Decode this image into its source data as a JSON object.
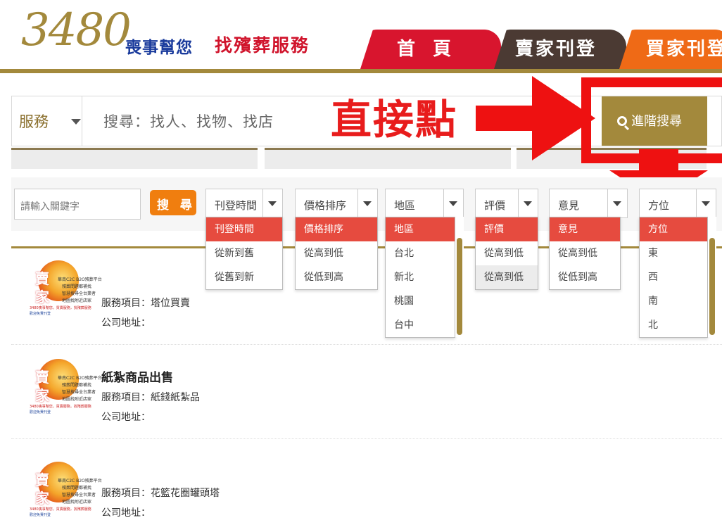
{
  "header": {
    "logo_number": "3480",
    "tagline_1": "喪事幫您",
    "tagline_2": "找殯葬服務",
    "nav": [
      {
        "label": "首 頁"
      },
      {
        "label": "賣家刊登"
      },
      {
        "label": "買家刊登"
      }
    ]
  },
  "search": {
    "category": "服務",
    "placeholder": "搜尋：找人、找物、找店",
    "advanced_label": "進階搜尋"
  },
  "annotation": {
    "text": "直接點"
  },
  "filters": {
    "keyword_placeholder": "請輸入關鍵字",
    "go_label": "搜 尋",
    "selects": [
      {
        "label": "刊登時間",
        "options": [
          "刊登時間",
          "從新到舊",
          "從舊到新"
        ]
      },
      {
        "label": "價格排序",
        "options": [
          "價格排序",
          "從高到低",
          "從低到高"
        ]
      },
      {
        "label": "地區",
        "options": [
          "地區",
          "台北",
          "新北",
          "桃園",
          "台中"
        ]
      },
      {
        "label": "評價",
        "options": [
          "評價",
          "從高到低",
          "從高到低"
        ]
      },
      {
        "label": "意見",
        "options": [
          "意見",
          "從高到低",
          "從低到高"
        ]
      },
      {
        "label": "方位",
        "options": [
          "方位",
          "東",
          "西",
          "南",
          "北"
        ]
      }
    ]
  },
  "listings": [
    {
      "title": "",
      "service": "服務項目：塔位買賣",
      "address": "公司地址："
    },
    {
      "title": "紙紮商品出售",
      "service": "服務項目：紙錢紙紮品",
      "address": "公司地址："
    },
    {
      "title": "",
      "service": "服務項目：花籃花圈罐頭塔",
      "address": "公司地址："
    }
  ],
  "logo_badge": {
    "char_1": "賣",
    "char_2": "家",
    "line_1": "華南C2C B2O殯葬平台",
    "line_2": "殯葬問題都補找",
    "line_3": "智慧搜尋全台業者",
    "line_4": "地圖找附近店家",
    "line_5": "3480喪事幫您，買賣服務，找殯葬服務",
    "line_6": "歡迎免費刊登"
  },
  "colors": {
    "gold": "#a3893c",
    "home_tab": "#d8152e",
    "seller_tab": "#4b3a33",
    "buyer_tab": "#ef6a16",
    "annotation_red": "#e81c1c",
    "option_selected": "#e64b3f"
  }
}
